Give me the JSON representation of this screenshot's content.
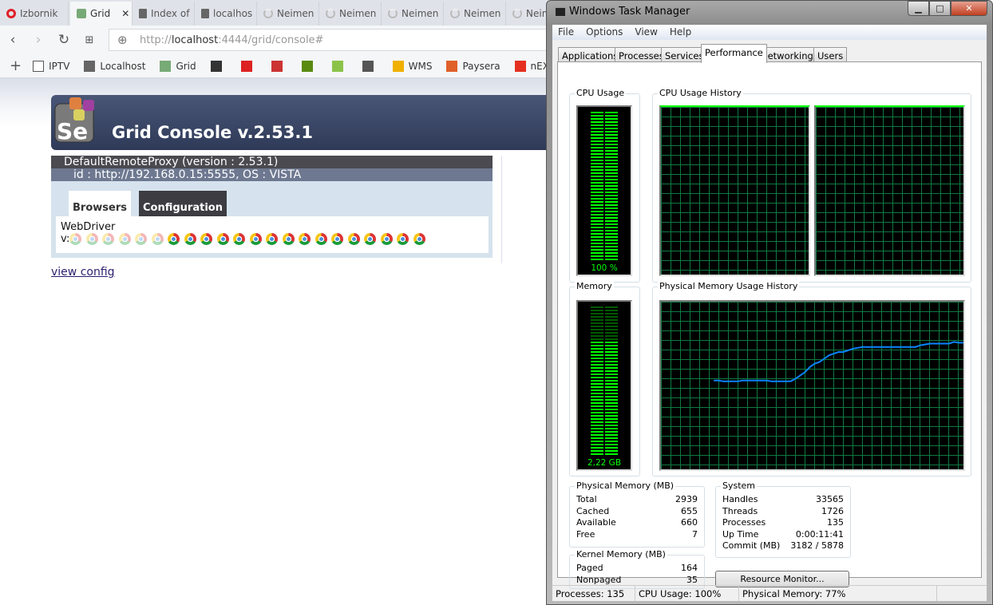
{
  "browser": {
    "tabs": [
      {
        "label": "Izbornik",
        "icon": "opera-icon"
      },
      {
        "label": "Grid",
        "icon": "grid-check-icon",
        "active": true
      },
      {
        "label": "Index of",
        "icon": "document-icon"
      },
      {
        "label": "localhos",
        "icon": "document-icon"
      },
      {
        "label": "Neimen",
        "icon": "loading-icon"
      },
      {
        "label": "Neimen",
        "icon": "loading-icon"
      },
      {
        "label": "Neimen",
        "icon": "loading-icon"
      },
      {
        "label": "Neimen",
        "icon": "loading-icon"
      },
      {
        "label": "Neimen",
        "icon": "loading-icon"
      }
    ],
    "url_prefix": "http://",
    "url_host": "localhost",
    "url_rest": ":4444/grid/console#",
    "bookmarks": [
      {
        "label": "IPTV",
        "icon": "folder-icon"
      },
      {
        "label": "Localhost",
        "icon": "document-icon"
      },
      {
        "label": "Grid",
        "icon": "grid-check-icon"
      },
      {
        "label": "",
        "icon": "tools-icon"
      },
      {
        "label": "",
        "icon": "red-checker-icon"
      },
      {
        "label": "",
        "icon": "enet-icon"
      },
      {
        "label": "",
        "icon": "monitor-icon"
      },
      {
        "label": "",
        "icon": "android-download-icon"
      },
      {
        "label": "",
        "icon": "cart-icon"
      },
      {
        "label": "WMS",
        "icon": "wms-icon"
      },
      {
        "label": "Paysera",
        "icon": "paysera-icon"
      },
      {
        "label": "nEXB",
        "icon": "nexb-icon"
      }
    ]
  },
  "grid": {
    "title": "Grid Console v.2.53.1",
    "proxy_title": "DefaultRemoteProxy (version : 2.53.1)",
    "proxy_id": "id : http://192.168.0.15:5555, OS : VISTA",
    "tab_browsers": "Browsers",
    "tab_configuration": "Configuration",
    "protocol": "WebDriver",
    "version_prefix": "v:",
    "browser_slots": {
      "total": 22,
      "busy": 16,
      "idle": 6
    },
    "view_config": "view config"
  },
  "taskmgr": {
    "title": "Windows Task Manager",
    "menu": [
      "File",
      "Options",
      "View",
      "Help"
    ],
    "tabs": [
      "Applications",
      "Processes",
      "Services",
      "Performance",
      "Networking",
      "Users"
    ],
    "active_tab": "Performance",
    "cpu_usage_label": "CPU Usage",
    "cpu_usage_value": "100 %",
    "cpu_usage_percent": 100,
    "cpu_history_label": "CPU Usage History",
    "cpu_history_cores": [
      100,
      100
    ],
    "memory_label": "Memory",
    "memory_value": "2,22 GB",
    "memory_percent": 77,
    "mem_history_label": "Physical Memory Usage History",
    "physical_memory": {
      "label": "Physical Memory (MB)",
      "rows": [
        [
          "Total",
          "2939"
        ],
        [
          "Cached",
          "655"
        ],
        [
          "Available",
          "660"
        ],
        [
          "Free",
          "7"
        ]
      ]
    },
    "kernel_memory": {
      "label": "Kernel Memory (MB)",
      "rows": [
        [
          "Paged",
          "164"
        ],
        [
          "Nonpaged",
          "35"
        ]
      ]
    },
    "system": {
      "label": "System",
      "rows": [
        [
          "Handles",
          "33565"
        ],
        [
          "Threads",
          "1726"
        ],
        [
          "Processes",
          "135"
        ],
        [
          "Up Time",
          "0:00:11:41"
        ],
        [
          "Commit (MB)",
          "3182 / 5878"
        ]
      ]
    },
    "resource_monitor": "Resource Monitor...",
    "status": {
      "processes": "Processes: 135",
      "cpu": "CPU Usage: 100%",
      "memory": "Physical Memory: 77%"
    }
  },
  "chart_data": {
    "type": "line",
    "title": "Physical Memory Usage History",
    "ylim": [
      0,
      100
    ],
    "grid": true,
    "series": [
      {
        "color": "#0a84ff",
        "values": [
          null,
          null,
          null,
          null,
          null,
          null,
          null,
          null,
          null,
          null,
          null,
          53,
          53,
          52.5,
          52.5,
          52.5,
          52.5,
          53,
          53,
          53,
          53,
          53,
          53,
          52.5,
          52.5,
          52.5,
          52.5,
          52.5,
          54,
          56,
          58,
          61,
          63,
          64,
          66,
          68,
          69,
          70,
          70,
          71,
          72,
          72.5,
          73,
          73,
          73,
          73,
          73,
          73,
          73,
          73,
          73,
          73,
          73,
          73,
          74,
          74.5,
          75,
          75,
          75,
          75,
          75,
          76,
          75.5,
          75.5
        ]
      }
    ]
  }
}
